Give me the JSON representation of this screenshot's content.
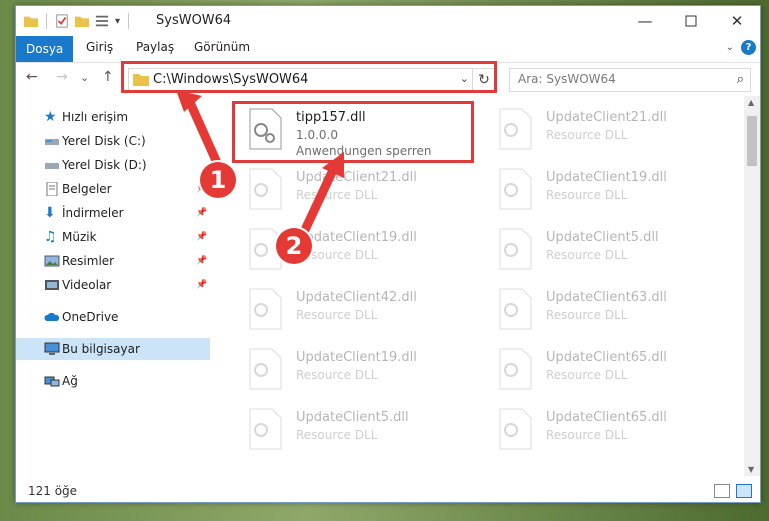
{
  "window": {
    "title": "SysWOW64",
    "qat_dropdown": "▾"
  },
  "ribbon": {
    "tabs": [
      "Dosya",
      "Giriş",
      "Paylaş",
      "Görünüm"
    ],
    "active_tab": "Dosya",
    "help": "?"
  },
  "nav": {
    "back": "←",
    "forward": "→",
    "recent": "⌄",
    "up": "↑",
    "address": "C:\\Windows\\SysWOW64",
    "address_dropdown": "⌄",
    "refresh": "↻",
    "search_placeholder": "Ara: SysWOW64",
    "search_icon": "⌕"
  },
  "sidebar": {
    "items": [
      {
        "label": "Hızlı erişim",
        "icon": "star-icon",
        "pinned": false
      },
      {
        "label": "Yerel Disk (C:)",
        "icon": "drive-icon",
        "pinned": false
      },
      {
        "label": "Yerel Disk (D:)",
        "icon": "drive-icon",
        "pinned": false
      },
      {
        "label": "Belgeler",
        "icon": "documents-icon",
        "pinned": true
      },
      {
        "label": "İndirmeler",
        "icon": "download-icon",
        "pinned": true
      },
      {
        "label": "Müzik",
        "icon": "music-icon",
        "pinned": true
      },
      {
        "label": "Resimler",
        "icon": "pictures-icon",
        "pinned": true
      },
      {
        "label": "Videolar",
        "icon": "video-icon",
        "pinned": true
      },
      {
        "label": "OneDrive",
        "icon": "cloud-icon",
        "pinned": false
      },
      {
        "label": "Bu bilgisayar",
        "icon": "computer-icon",
        "pinned": false,
        "selected": true
      },
      {
        "label": "Ağ",
        "icon": "network-icon",
        "pinned": false
      }
    ]
  },
  "files": {
    "highlighted": {
      "name": "tipp157.dll",
      "version": "1.0.0.0",
      "description": "Anwendungen sperren"
    },
    "left_column": [
      {
        "name": "UpdateClient21.dll",
        "type": "Resource DLL"
      },
      {
        "name": "UpdateClient19.dll",
        "type": "Resource DLL"
      },
      {
        "name": "UpdateClient42.dll",
        "type": "Resource DLL"
      },
      {
        "name": "UpdateClient19.dll",
        "type": "Resource DLL"
      },
      {
        "name": "UpdateClient5.dll",
        "type": "Resource DLL"
      }
    ],
    "right_column": [
      {
        "name": "UpdateClient21.dll",
        "type": "Resource DLL"
      },
      {
        "name": "UpdateClient19.dll",
        "type": "Resource DLL"
      },
      {
        "name": "UpdateClient5.dll",
        "type": "Resource DLL"
      },
      {
        "name": "UpdateClient63.dll",
        "type": "Resource DLL"
      },
      {
        "name": "UpdateClient65.dll",
        "type": "Resource DLL"
      },
      {
        "name": "UpdateClient65.dll",
        "type": "Resource DLL"
      }
    ]
  },
  "status": {
    "item_count": "121 öğe"
  },
  "annotations": {
    "step1": "1",
    "step2": "2",
    "color": "#e53935"
  },
  "colors": {
    "accent": "#1979ca",
    "selected": "#cce4f7"
  }
}
